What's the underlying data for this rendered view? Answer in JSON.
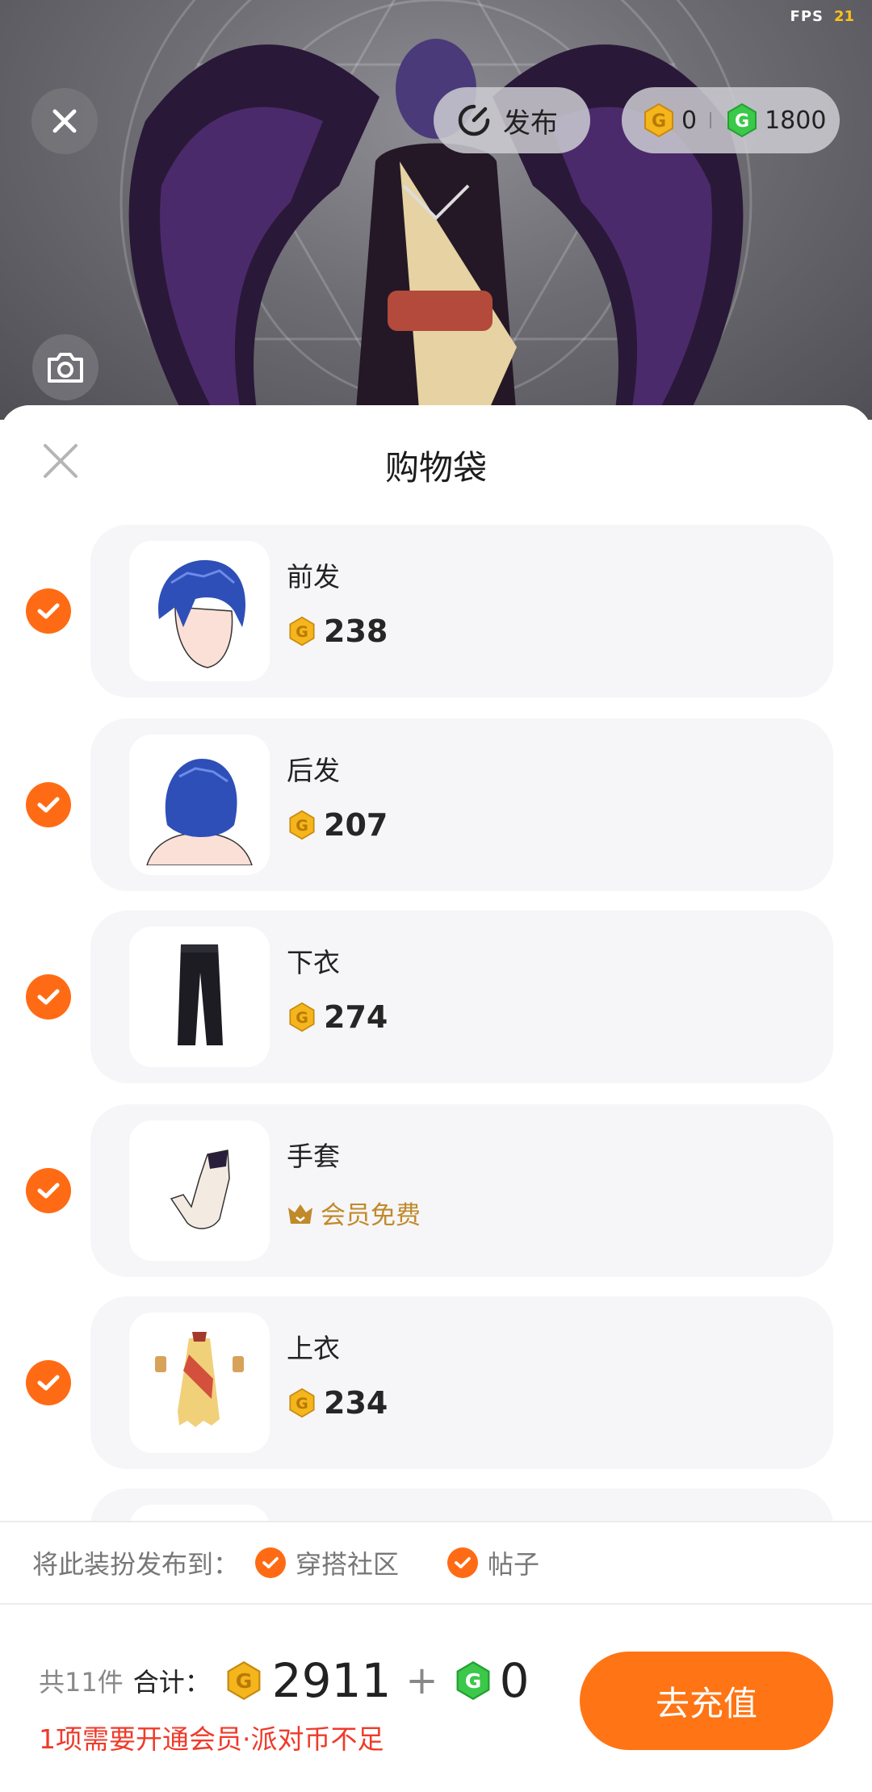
{
  "status": {
    "fps_label": "FPS",
    "fps_value": "21"
  },
  "toolbar": {
    "publish_label": "发布",
    "coin_gold": "0",
    "coin_green": "1800",
    "icons": {
      "close": "close-icon",
      "publish": "refresh-icon",
      "camera": "camera-icon"
    }
  },
  "sheet": {
    "title": "购物袋"
  },
  "items": [
    {
      "name": "前发",
      "price": "238",
      "vip": ""
    },
    {
      "name": "后发",
      "price": "207",
      "vip": ""
    },
    {
      "name": "下衣",
      "price": "274",
      "vip": ""
    },
    {
      "name": "手套",
      "price": "",
      "vip": "会员免费"
    },
    {
      "name": "上衣",
      "price": "234",
      "vip": ""
    }
  ],
  "publish_to": {
    "label": "将此装扮发布到：",
    "options": [
      {
        "label": "穿搭社区",
        "checked": true
      },
      {
        "label": "帖子",
        "checked": true
      }
    ]
  },
  "footer": {
    "count": "共11件",
    "total_label": "合计：",
    "total_gold": "2911",
    "plus": "+",
    "total_green": "0",
    "warning": "1项需要开通会员·派对币不足",
    "recharge_label": "去充值"
  },
  "colors": {
    "accent": "#ff6b14",
    "gold_coin": "#f5b51c",
    "green_coin": "#3cc84b",
    "warning": "#f03a2a",
    "vip": "#c08a2a"
  }
}
